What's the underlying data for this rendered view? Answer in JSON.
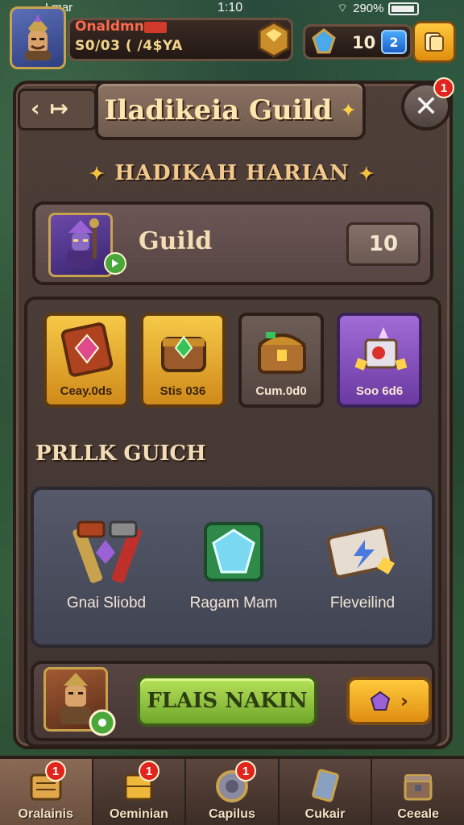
{
  "status_bar": {
    "left_text": "Lmar",
    "time": "1:10",
    "battery_text": "290%"
  },
  "hud": {
    "player_name": "Onaldmn",
    "player_stats": "S0/03 ( /4$YA",
    "currency_value": "10",
    "currency_badge": "2"
  },
  "panel": {
    "title": "Iladikeia Guild",
    "close_notification": "1"
  },
  "daily": {
    "heading": "HADIKAH HARIAN",
    "guild_label": "Guild",
    "guild_value": "10"
  },
  "rewards": [
    {
      "label": "Ceay.0ds",
      "style": "gold",
      "icon": "ruby-frame-icon"
    },
    {
      "label": "Stis 036",
      "style": "gold",
      "icon": "emerald-chest-icon"
    },
    {
      "label": "Cum.0d0",
      "style": "stone",
      "icon": "treasure-chest-icon"
    },
    {
      "label": "Soo 6d6",
      "style": "purple",
      "icon": "crystal-box-icon"
    }
  ],
  "guild_section": {
    "heading": "PRLLK GUICH",
    "items": [
      {
        "label": "Gnai Sliobd",
        "icon": "crossed-hammers-icon"
      },
      {
        "label": "Ragam Mam",
        "icon": "crystal-shield-icon"
      },
      {
        "label": "Fleveilind",
        "icon": "magic-tome-icon"
      }
    ]
  },
  "action": {
    "claim_label": "FLAIS NAKIN"
  },
  "bottom_nav": [
    {
      "label": "Oralainis",
      "badge": "1",
      "icon": "scroll-icon",
      "active": true
    },
    {
      "label": "Oeminian",
      "badge": "1",
      "icon": "crate-icon",
      "active": false
    },
    {
      "label": "Capilus",
      "badge": "1",
      "icon": "shield-icon",
      "active": false
    },
    {
      "label": "Cukair",
      "badge": "",
      "icon": "card-icon",
      "active": false
    },
    {
      "label": "Ceeale",
      "badge": "",
      "icon": "chest-icon",
      "active": false
    }
  ],
  "colors": {
    "panel_bg": "#4f3f39",
    "accent_gold": "#ffc93d",
    "claim_green": "#8fc23a",
    "notification_red": "#e1241e"
  }
}
